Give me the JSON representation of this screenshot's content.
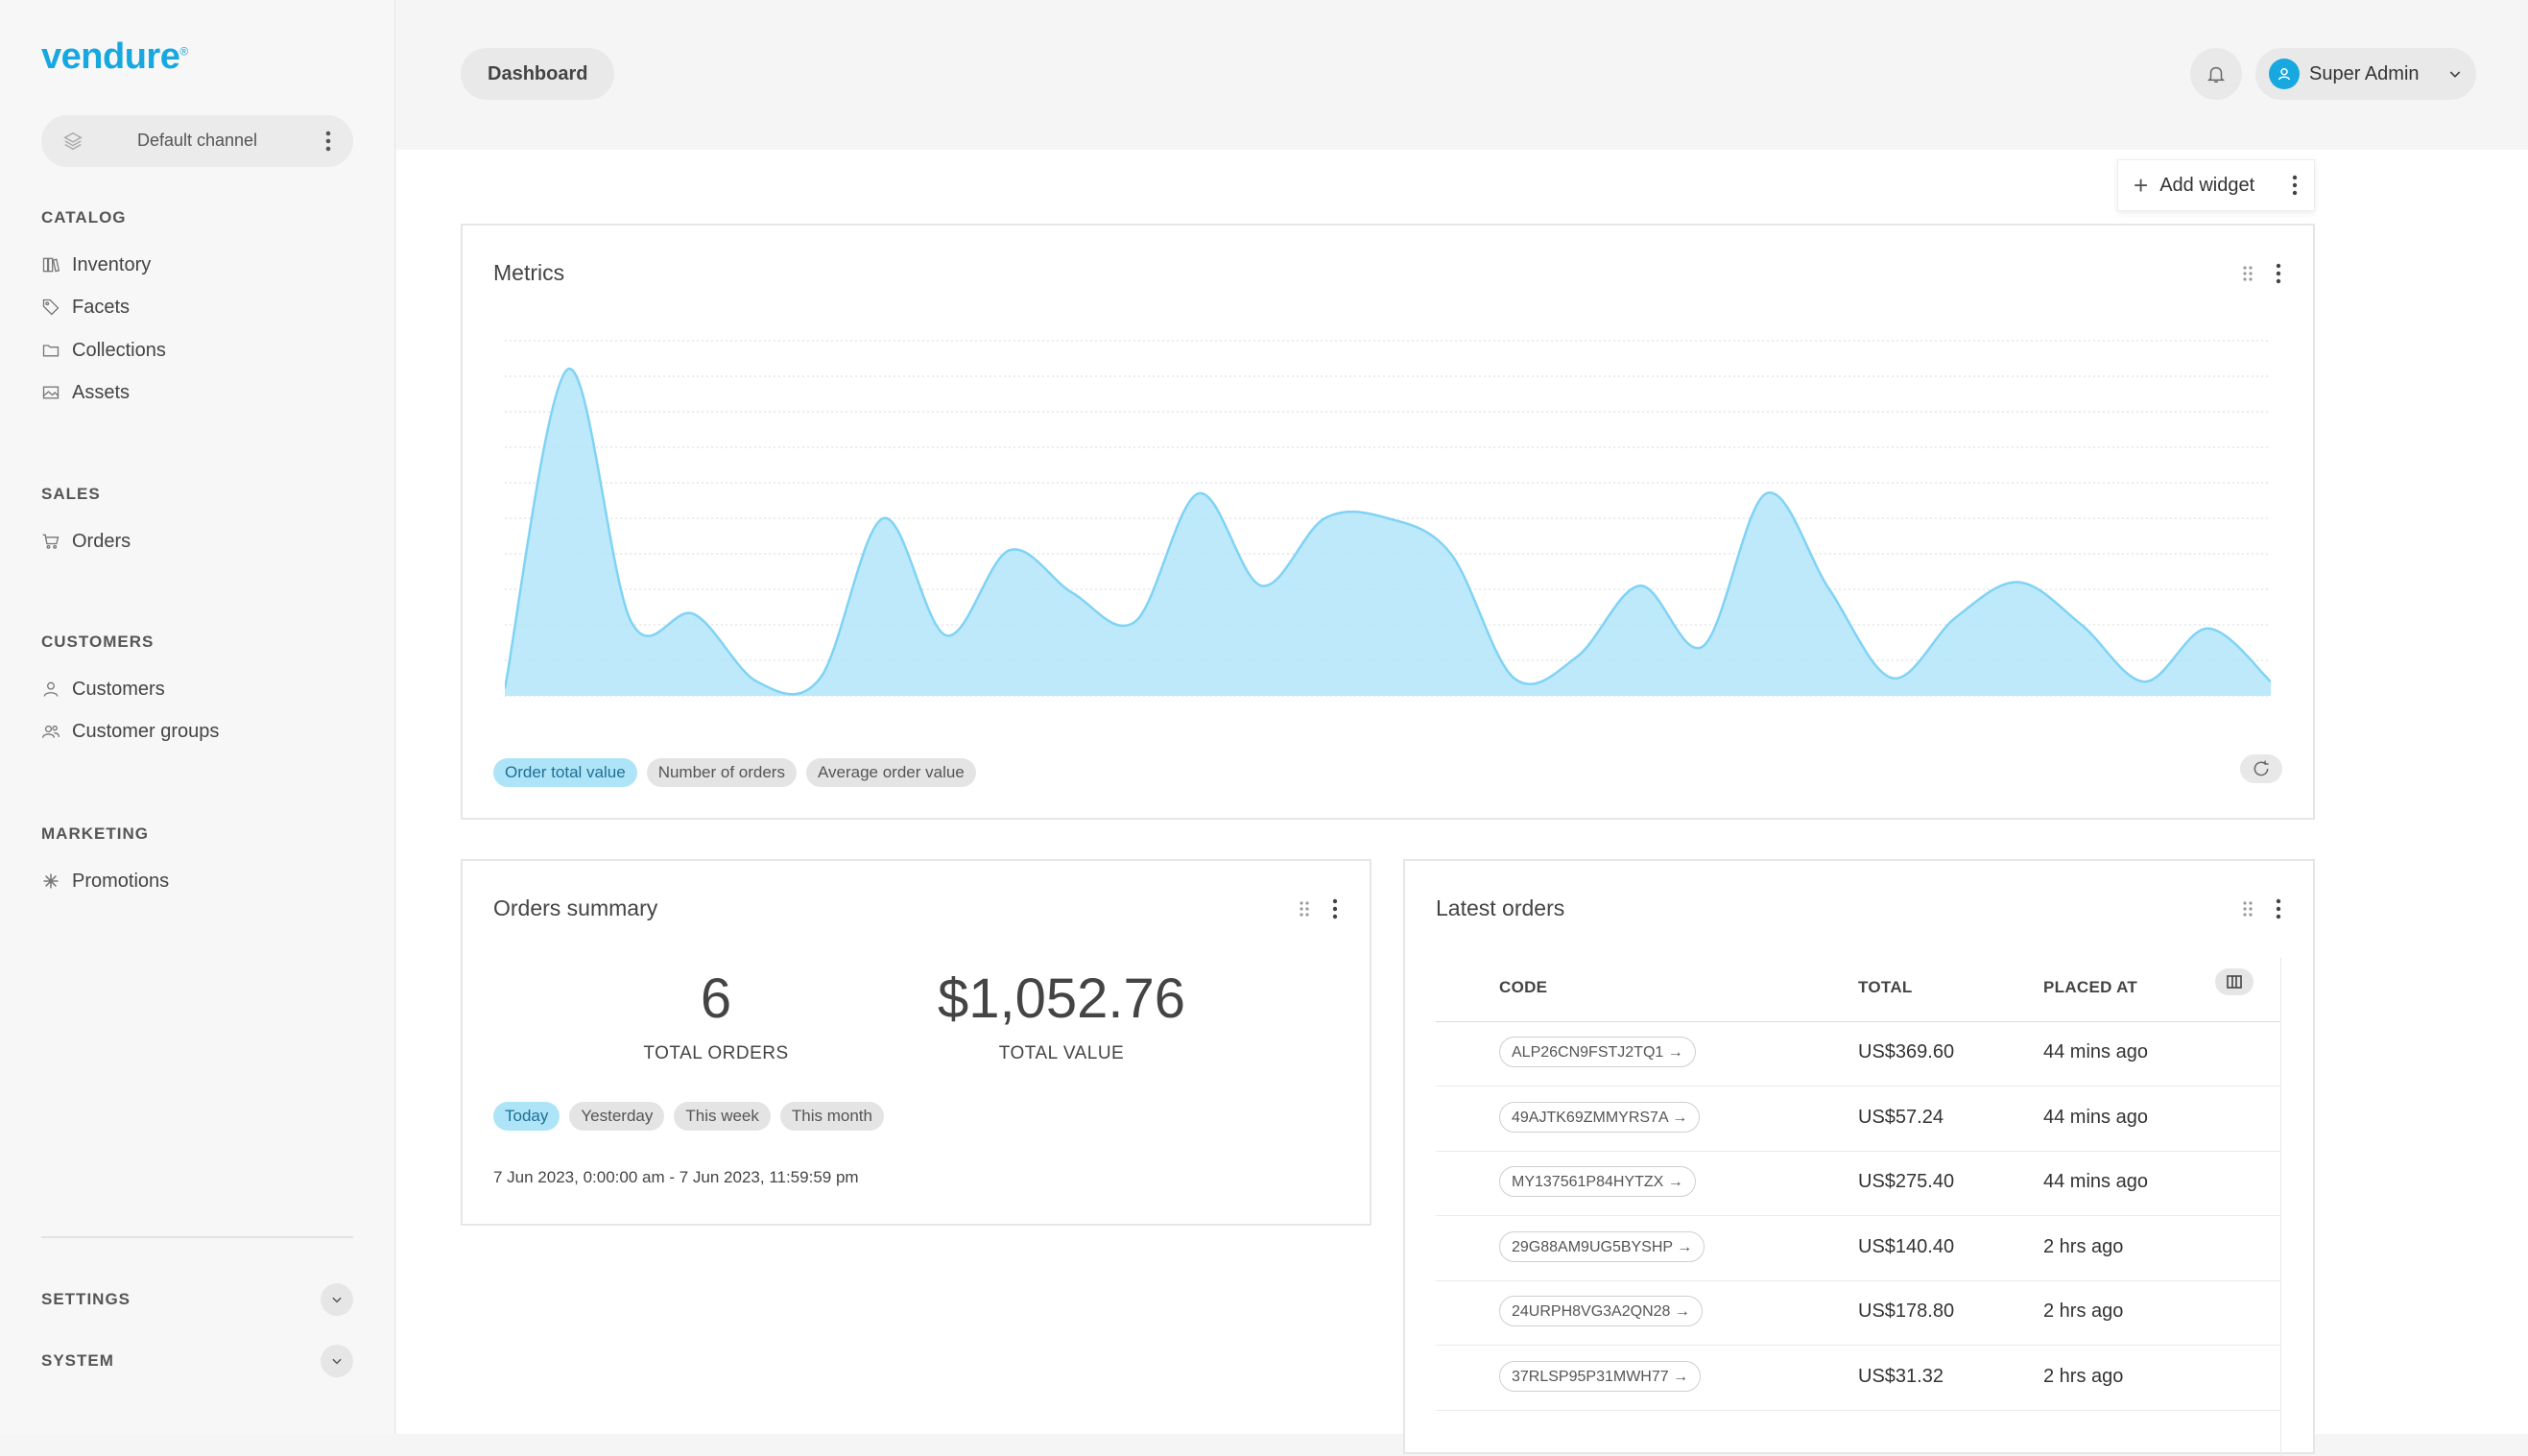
{
  "app": {
    "logo": "vendure",
    "logo_mark": "®"
  },
  "channel": {
    "label": "Default channel"
  },
  "sidebar": {
    "sections": [
      {
        "title": "CATALOG",
        "items": [
          {
            "label": "Inventory",
            "icon": "inventory-icon"
          },
          {
            "label": "Facets",
            "icon": "tag-icon"
          },
          {
            "label": "Collections",
            "icon": "folder-icon"
          },
          {
            "label": "Assets",
            "icon": "image-icon"
          }
        ]
      },
      {
        "title": "SALES",
        "items": [
          {
            "label": "Orders",
            "icon": "cart-icon"
          }
        ]
      },
      {
        "title": "CUSTOMERS",
        "items": [
          {
            "label": "Customers",
            "icon": "user-icon"
          },
          {
            "label": "Customer groups",
            "icon": "users-icon"
          }
        ]
      },
      {
        "title": "MARKETING",
        "items": [
          {
            "label": "Promotions",
            "icon": "asterisk-icon"
          }
        ]
      }
    ],
    "collapsibles": [
      {
        "label": "SETTINGS"
      },
      {
        "label": "SYSTEM"
      }
    ]
  },
  "header": {
    "breadcrumb": "Dashboard",
    "user": "Super Admin"
  },
  "toolbar": {
    "add_widget": "Add widget"
  },
  "metrics": {
    "title": "Metrics",
    "tabs": [
      {
        "label": "Order total value",
        "active": true
      },
      {
        "label": "Number of orders",
        "active": false
      },
      {
        "label": "Average order value",
        "active": false
      }
    ],
    "chart_data": {
      "type": "area",
      "series": [
        {
          "values": [
            2,
            92,
            21,
            23,
            4,
            5,
            50,
            17,
            41,
            29,
            21,
            57,
            31,
            50,
            50,
            40,
            5,
            11,
            31,
            14,
            57,
            30,
            5,
            22,
            32,
            20,
            4,
            19,
            4
          ]
        }
      ],
      "grid": true,
      "color": "#b3e5fa",
      "line_color": "#7fd3f4"
    }
  },
  "orders_summary": {
    "title": "Orders summary",
    "total_orders": "6",
    "total_orders_label": "TOTAL ORDERS",
    "total_value": "$1,052.76",
    "total_value_label": "TOTAL VALUE",
    "ranges": [
      {
        "label": "Today",
        "active": true
      },
      {
        "label": "Yesterday",
        "active": false
      },
      {
        "label": "This week",
        "active": false
      },
      {
        "label": "This month",
        "active": false
      }
    ],
    "date_range": "7 Jun 2023, 0:00:00 am - 7 Jun 2023, 11:59:59 pm"
  },
  "latest_orders": {
    "title": "Latest orders",
    "columns": {
      "code": "CODE",
      "total": "TOTAL",
      "placed_at": "PLACED AT"
    },
    "rows": [
      {
        "code": "ALP26CN9FSTJ2TQ1",
        "total": "US$369.60",
        "placed": "44 mins ago"
      },
      {
        "code": "49AJTK69ZMMYRS7A",
        "total": "US$57.24",
        "placed": "44 mins ago"
      },
      {
        "code": "MY137561P84HYTZX",
        "total": "US$275.40",
        "placed": "44 mins ago"
      },
      {
        "code": "29G88AM9UG5BYSHP",
        "total": "US$140.40",
        "placed": "2 hrs ago"
      },
      {
        "code": "24URPH8VG3A2QN28",
        "total": "US$178.80",
        "placed": "2 hrs ago"
      },
      {
        "code": "37RLSP95P31MWH77",
        "total": "US$31.32",
        "placed": "2 hrs ago"
      }
    ]
  }
}
